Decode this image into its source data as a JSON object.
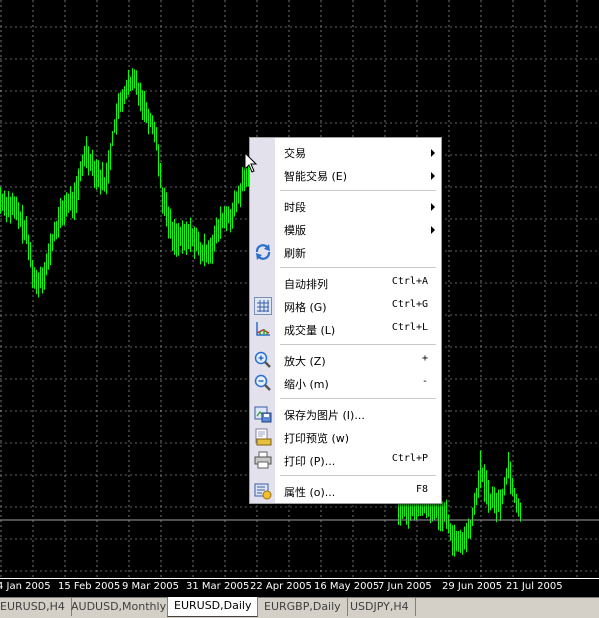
{
  "chart": {
    "symbol": "EURUSD",
    "timeframe": "Daily",
    "background": "#000000",
    "candle_color": "#00ff00",
    "grid_color": "#c0c0c0",
    "date_labels": [
      "4 Jan 2005",
      "15 Feb 2005",
      "9 Mar 2005",
      "31 Mar 2005",
      "22 Apr 2005",
      "16 May 2005",
      "7 Jun 2005",
      "29 Jun 2005",
      "21 Jul 2005"
    ]
  },
  "tabs": [
    {
      "label": "EURUSD,H4",
      "active": false
    },
    {
      "label": "AUDUSD,Monthly",
      "active": false
    },
    {
      "label": "EURUSD,Daily",
      "active": true
    },
    {
      "label": "EURGBP,Daily",
      "active": false
    },
    {
      "label": "USDJPY,H4",
      "active": false
    }
  ],
  "context_menu": {
    "trade": {
      "label": "交易",
      "has_submenu": true
    },
    "expert_advisors": {
      "label": "智能交易 (E)",
      "has_submenu": true
    },
    "timeframes": {
      "label": "时段",
      "has_submenu": true
    },
    "templates": {
      "label": "模版",
      "has_submenu": true
    },
    "refresh": {
      "label": "刷新",
      "icon": "refresh-icon"
    },
    "auto_scroll": {
      "label": "自动排列",
      "shortcut": "Ctrl+A"
    },
    "grid": {
      "label": "网格 (G)",
      "shortcut": "Ctrl+G",
      "icon": "grid-icon"
    },
    "volumes": {
      "label": "成交量 (L)",
      "shortcut": "Ctrl+L",
      "icon": "volumes-icon"
    },
    "zoom_in": {
      "label": "放大 (Z)",
      "shortcut": "+",
      "icon": "zoom-in-icon"
    },
    "zoom_out": {
      "label": "缩小 (m)",
      "shortcut": "-",
      "icon": "zoom-out-icon"
    },
    "save_as_picture": {
      "label": "保存为图片 (I)...",
      "icon": "save-picture-icon"
    },
    "print_preview": {
      "label": "打印预览 (w)",
      "icon": "print-preview-icon"
    },
    "print": {
      "label": "打印 (P)...",
      "shortcut": "Ctrl+P",
      "icon": "print-icon"
    },
    "properties": {
      "label": "属性 (o)...",
      "shortcut": "F8",
      "icon": "properties-icon"
    }
  }
}
